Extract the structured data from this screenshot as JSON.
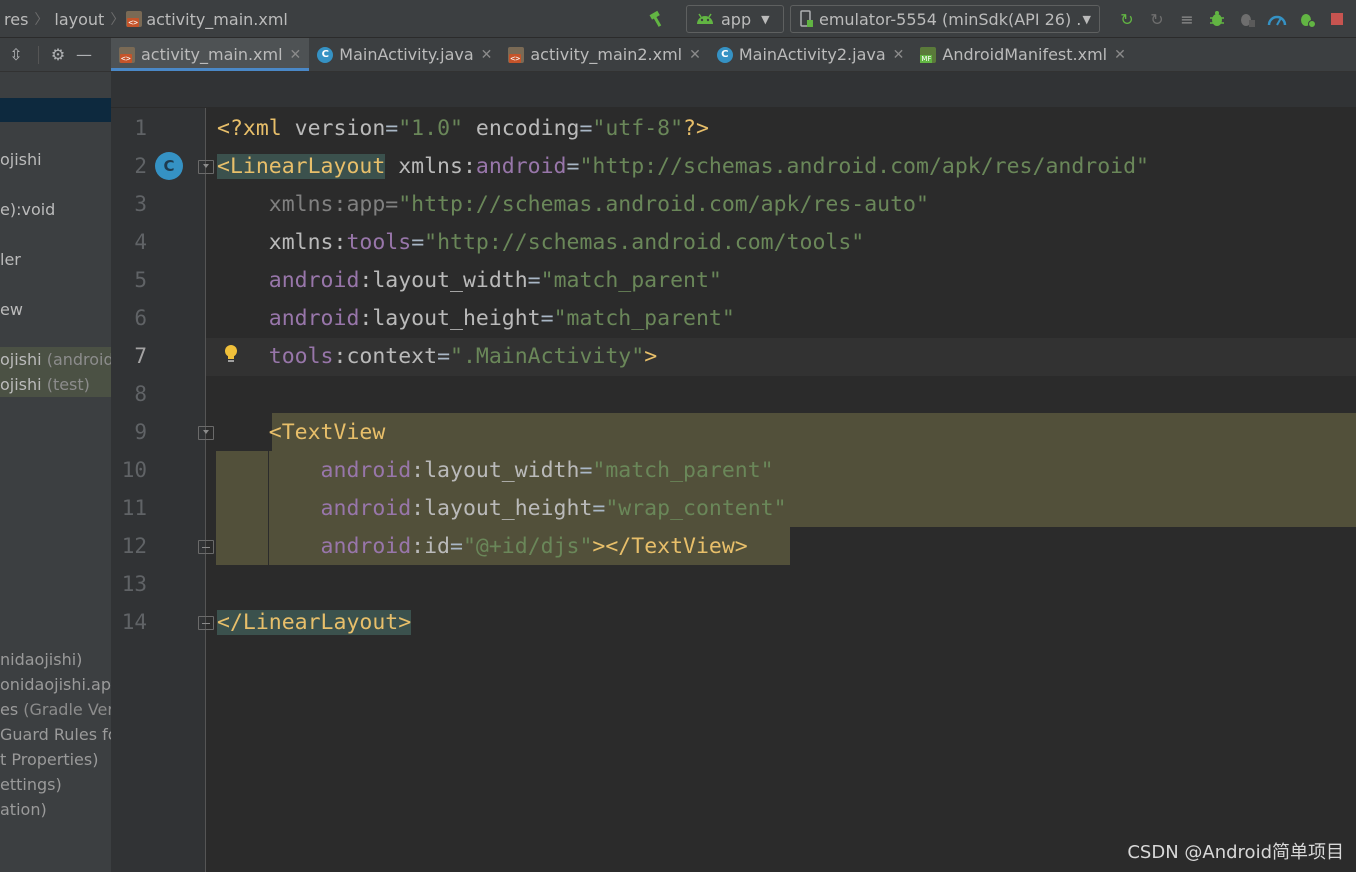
{
  "breadcrumb": {
    "items": [
      "res",
      "layout",
      "activity_main.xml"
    ]
  },
  "toolbar": {
    "hammer_icon": "hammer-icon",
    "run_config": "app",
    "device": "emulator-5554 (minSdk(API 26) ...",
    "icons": [
      "apply-changes-icon",
      "apply-code-changes-icon",
      "logcat-icon",
      "debug-icon",
      "attach-debugger-icon",
      "profiler-icon",
      "debug-app-icon",
      "stop-icon"
    ],
    "colors": {
      "accent_green": "#499c54",
      "stop_red": "#c75450"
    }
  },
  "tabs": [
    {
      "label": "activity_main.xml",
      "icon": "xml-file-icon",
      "active": true
    },
    {
      "label": "MainActivity.java",
      "icon": "class-icon",
      "active": false
    },
    {
      "label": "activity_main2.xml",
      "icon": "xml-file-icon",
      "active": false
    },
    {
      "label": "MainActivity2.java",
      "icon": "class-icon",
      "active": false
    },
    {
      "label": "AndroidManifest.xml",
      "icon": "manifest-icon",
      "active": false
    }
  ],
  "project_tree": {
    "items": [
      {
        "text": "ojishi",
        "muted": ""
      },
      {
        "text": "e):void",
        "muted": ""
      },
      {
        "text": "ler",
        "muted": ""
      },
      {
        "text": "ew",
        "muted": ""
      },
      {
        "text": "ojishi",
        "muted": " (androidT"
      },
      {
        "text": "ojishi",
        "muted": " (test)"
      },
      {
        "text": "nidaojishi)",
        "muted": ""
      },
      {
        "text": "onidaojishi.app",
        "muted": ""
      },
      {
        "text": "es",
        "muted": " (Gradle Versi"
      },
      {
        "text": "Guard Rules for",
        "muted": ""
      },
      {
        "text": "t Properties)",
        "muted": ""
      },
      {
        "text": "ettings)",
        "muted": ""
      },
      {
        "text": "ation)",
        "muted": ""
      }
    ]
  },
  "editor": {
    "line_numbers": [
      "1",
      "2",
      "3",
      "4",
      "5",
      "6",
      "7",
      "8",
      "9",
      "10",
      "11",
      "12",
      "13",
      "14"
    ],
    "current_line": "7",
    "code": {
      "l1": {
        "a": "<?xml ",
        "b": "version",
        "c": "=",
        "d": "\"1.0\"",
        "e": " encoding",
        "f": "=",
        "g": "\"utf-8\"",
        "h": "?>"
      },
      "l2": {
        "tag": "<LinearLayout",
        "a": " xmlns:",
        "ns": "android",
        "eq": "=",
        "val": "\"http://schemas.android.com/apk/res/android\""
      },
      "l3": {
        "a": "    xmlns:app=",
        "val": "\"http://schemas.android.com/apk/res-auto\""
      },
      "l4": {
        "a": "    xmlns:",
        "ns": "tools",
        "eq": "=",
        "val": "\"http://schemas.android.com/tools\""
      },
      "l5": {
        "ns": "    android",
        "a": ":layout_width",
        "eq": "=",
        "val": "\"match_parent\""
      },
      "l6": {
        "ns": "    android",
        "a": ":layout_height",
        "eq": "=",
        "val": "\"match_parent\""
      },
      "l7": {
        "ns": "    tools",
        "a": ":context",
        "eq": "=",
        "val": "\".MainActivity\"",
        "end": ">"
      },
      "l9": {
        "pad": "    ",
        "tag": "<TextView"
      },
      "l10": {
        "ns": "        android",
        "a": ":layout_width",
        "eq": "=",
        "val": "\"match_parent\""
      },
      "l11": {
        "ns": "        android",
        "a": ":layout_height",
        "eq": "=",
        "val": "\"wrap_content\""
      },
      "l12": {
        "ns": "        android",
        "a": ":id",
        "eq": "=",
        "val": "\"@+id/djs\"",
        "end": "></TextView>"
      },
      "l14": {
        "tag": "</LinearLayout>"
      }
    }
  },
  "watermark": "CSDN @Android简单项目"
}
